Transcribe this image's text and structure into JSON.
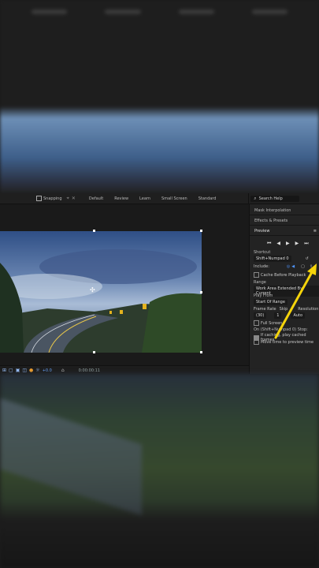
{
  "toolbar": {
    "snapping_label": "Snapping",
    "workspaces": [
      "Default",
      "Review",
      "Learn",
      "Small Screen",
      "Standard"
    ],
    "search_placeholder": "Search Help"
  },
  "panels": {
    "mask_interpolation": "Mask Interpolation",
    "effects_presets": "Effects & Presets",
    "preview_title": "Preview",
    "shortcut_label": "Shortcut",
    "shortcut_value": "Shift+Numpad 0",
    "include_label": "Include:",
    "cache_before_playback": "Cache Before Playback",
    "range_label": "Range",
    "range_value": "Work Area Extended By Current",
    "play_from_label": "Play From",
    "play_from_value": "Start Of Range",
    "frame_rate_label": "Frame Rate",
    "frame_rate_value": "(30)",
    "skip_label": "Skip",
    "skip_value": "1",
    "resolution_label": "Resolution",
    "resolution_value": "Auto",
    "full_screen": "Full Screen",
    "on_stop_label": "On (Shift+Numpad 0) Stop:",
    "if_caching": "If caching, play cached frames",
    "move_time": "Move time to preview time"
  },
  "composition": {
    "exposure_value": "+0.0",
    "timecode": "0:00:00:11"
  },
  "colors": {
    "accent": "#4f95ff",
    "arrow": "#f5d40b"
  }
}
